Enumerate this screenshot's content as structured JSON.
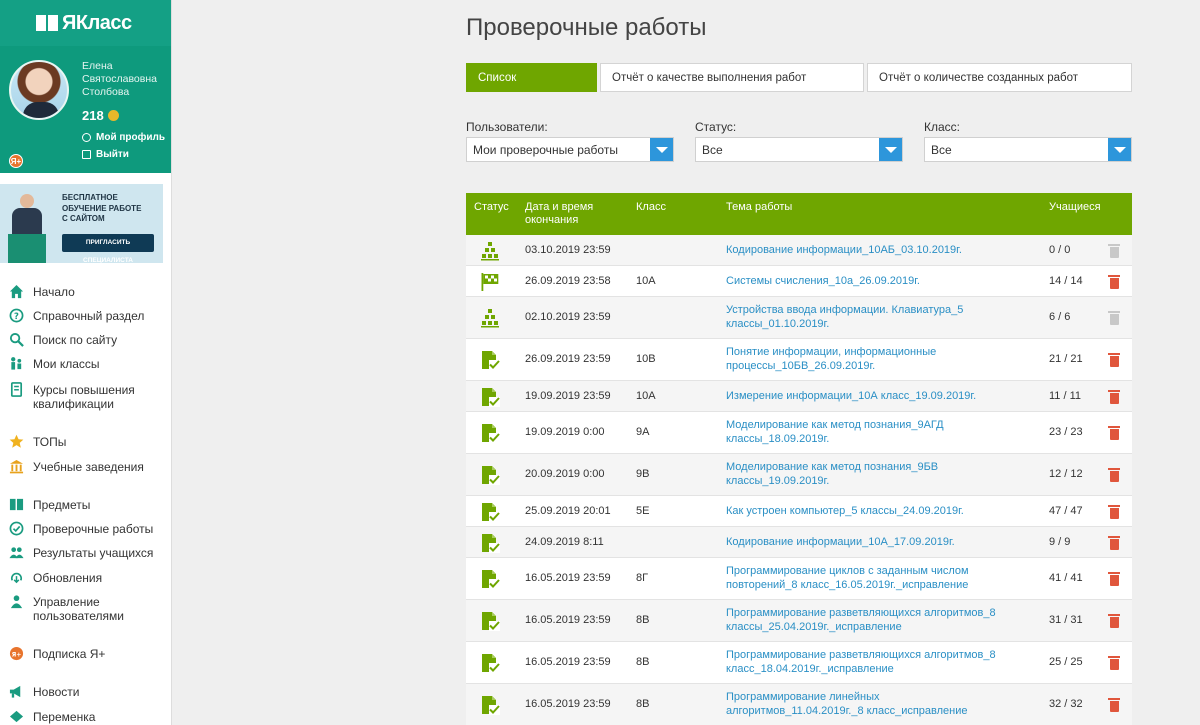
{
  "app": {
    "logo": "ЯКласс"
  },
  "profile": {
    "name_line1": "Елена",
    "name_line2": "Святославовна",
    "name_line3": "Столбова",
    "score": "218",
    "my_profile": "Мой профиль",
    "logout": "Выйти"
  },
  "promo": {
    "line1": "БЕСПЛАТНОЕ",
    "line2": "ОБУЧЕНИЕ РАБОТЕ",
    "line3": "С САЙТОМ",
    "button": "ПРИГЛАСИТЬ СПЕЦИАЛИСТА"
  },
  "nav": [
    {
      "label": "Начало",
      "icon": "home-icon"
    },
    {
      "label": "Справочный раздел",
      "icon": "help-icon"
    },
    {
      "label": "Поиск по сайту",
      "icon": "search-icon"
    },
    {
      "label": "Мои классы",
      "icon": "classes-icon"
    },
    {
      "label": "Курсы повышения квалификации",
      "icon": "courses-icon"
    },
    {
      "label": "ТОПы",
      "icon": "star-icon"
    },
    {
      "label": "Учебные заведения",
      "icon": "school-icon"
    },
    {
      "label": "Предметы",
      "icon": "subjects-icon"
    },
    {
      "label": "Проверочные работы",
      "icon": "check-icon"
    },
    {
      "label": "Результаты учащихся",
      "icon": "students-icon"
    },
    {
      "label": "Обновления",
      "icon": "updates-icon"
    },
    {
      "label": "Управление пользователями",
      "icon": "users-manage-icon"
    },
    {
      "label": "Подписка Я+",
      "icon": "subscription-icon"
    },
    {
      "label": "Новости",
      "icon": "news-icon"
    },
    {
      "label": "Переменка",
      "icon": "break-icon"
    }
  ],
  "page": {
    "title": "Проверочные работы",
    "tabs": [
      {
        "label": "Список"
      },
      {
        "label": "Отчёт о качестве выполнения работ"
      },
      {
        "label": "Отчёт о количестве созданных работ"
      }
    ]
  },
  "filters": {
    "users": {
      "label": "Пользователи:",
      "value": "Мои проверочные работы"
    },
    "status": {
      "label": "Статус:",
      "value": "Все"
    },
    "class": {
      "label": "Класс:",
      "value": "Все"
    }
  },
  "table": {
    "headers": {
      "status": "Статус",
      "date_line1": "Дата и время",
      "date_line2": "окончания",
      "class": "Класс",
      "topic": "Тема работы",
      "students": "Учащиеся"
    },
    "rows": [
      {
        "status": "pending",
        "date": "03.10.2019 23:59",
        "class": "",
        "topic1": "Кодирование информации_10АБ_03.10.2019г.",
        "topic2": "",
        "students": "0 / 0",
        "deletable": false
      },
      {
        "status": "finished",
        "date": "26.09.2019 23:58",
        "class": "10А",
        "topic1": "Системы счисления_10а_26.09.2019г.",
        "topic2": "",
        "students": "14 / 14",
        "deletable": true
      },
      {
        "status": "pending",
        "date": "02.10.2019 23:59",
        "class": "",
        "topic1": "Устройства ввода информации. Клавиатура_5",
        "topic2": "классы_01.10.2019г.",
        "students": "6 / 6",
        "deletable": false
      },
      {
        "status": "checked",
        "date": "26.09.2019 23:59",
        "class": "10В",
        "topic1": "Понятие информации, информационные",
        "topic2": "процессы_10БВ_26.09.2019г.",
        "students": "21 / 21",
        "deletable": true
      },
      {
        "status": "checked",
        "date": "19.09.2019 23:59",
        "class": "10А",
        "topic1": "Измерение информации_10А класс_19.09.2019г.",
        "topic2": "",
        "students": "11 / 11",
        "deletable": true
      },
      {
        "status": "checked",
        "date": "19.09.2019 0:00",
        "class": "9А",
        "topic1": "Моделирование как метод познания_9АГД",
        "topic2": "классы_18.09.2019г.",
        "students": "23 / 23",
        "deletable": true
      },
      {
        "status": "checked",
        "date": "20.09.2019 0:00",
        "class": "9В",
        "topic1": "Моделирование как метод познания_9БВ",
        "topic2": "классы_19.09.2019г.",
        "students": "12 / 12",
        "deletable": true
      },
      {
        "status": "checked",
        "date": "25.09.2019 20:01",
        "class": "5Е",
        "topic1": "Как устроен компьютер_5 классы_24.09.2019г.",
        "topic2": "",
        "students": "47 / 47",
        "deletable": true
      },
      {
        "status": "checked",
        "date": "24.09.2019 8:11",
        "class": "",
        "topic1": "Кодирование информации_10А_17.09.2019г.",
        "topic2": "",
        "students": "9 / 9",
        "deletable": true
      },
      {
        "status": "checked",
        "date": "16.05.2019 23:59",
        "class": "8Г",
        "topic1": "Программирование циклов с заданным числом",
        "topic2": "повторений_8 класс_16.05.2019г._исправление",
        "students": "41 / 41",
        "deletable": true
      },
      {
        "status": "checked",
        "date": "16.05.2019 23:59",
        "class": "8В",
        "topic1": "Программирование разветвляющихся алгоритмов_8",
        "topic2": "классы_25.04.2019г._исправление",
        "students": "31 / 31",
        "deletable": true
      },
      {
        "status": "checked",
        "date": "16.05.2019 23:59",
        "class": "8В",
        "topic1": "Программирование разветвляющихся алгоритмов_8",
        "topic2": "класс_18.04.2019г._исправление",
        "students": "25 / 25",
        "deletable": true
      },
      {
        "status": "checked",
        "date": "16.05.2019 23:59",
        "class": "8В",
        "topic1": "Программирование линейных",
        "topic2": "алгоритмов_11.04.2019г._8 класс_исправление",
        "students": "32 / 32",
        "deletable": true
      }
    ]
  }
}
